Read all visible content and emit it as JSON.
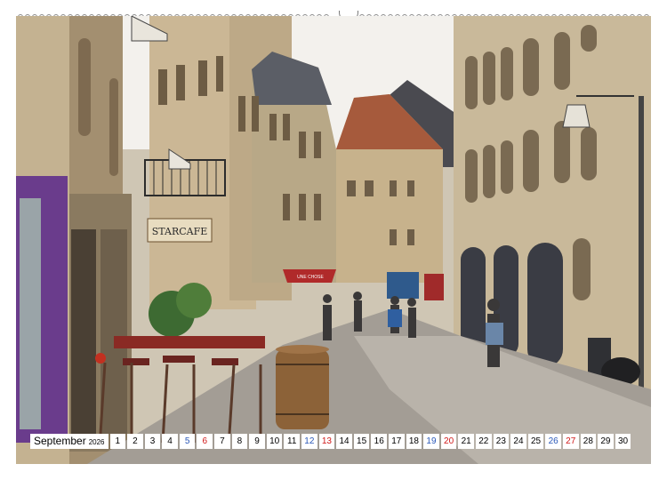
{
  "calendar": {
    "month": "September",
    "year": "2026",
    "days": [
      {
        "n": "1",
        "kind": ""
      },
      {
        "n": "2",
        "kind": ""
      },
      {
        "n": "3",
        "kind": ""
      },
      {
        "n": "4",
        "kind": ""
      },
      {
        "n": "5",
        "kind": "sat"
      },
      {
        "n": "6",
        "kind": "sun"
      },
      {
        "n": "7",
        "kind": ""
      },
      {
        "n": "8",
        "kind": ""
      },
      {
        "n": "9",
        "kind": ""
      },
      {
        "n": "10",
        "kind": ""
      },
      {
        "n": "11",
        "kind": ""
      },
      {
        "n": "12",
        "kind": "sat"
      },
      {
        "n": "13",
        "kind": "sun"
      },
      {
        "n": "14",
        "kind": ""
      },
      {
        "n": "15",
        "kind": ""
      },
      {
        "n": "16",
        "kind": ""
      },
      {
        "n": "17",
        "kind": ""
      },
      {
        "n": "18",
        "kind": ""
      },
      {
        "n": "19",
        "kind": "sat"
      },
      {
        "n": "20",
        "kind": "sun"
      },
      {
        "n": "21",
        "kind": ""
      },
      {
        "n": "22",
        "kind": ""
      },
      {
        "n": "23",
        "kind": ""
      },
      {
        "n": "24",
        "kind": ""
      },
      {
        "n": "25",
        "kind": ""
      },
      {
        "n": "26",
        "kind": "sat"
      },
      {
        "n": "27",
        "kind": "sun"
      },
      {
        "n": "28",
        "kind": ""
      },
      {
        "n": "29",
        "kind": ""
      },
      {
        "n": "30",
        "kind": ""
      }
    ]
  },
  "photo": {
    "signs": {
      "cafe": "STARCAFE",
      "shop": "UNE CHOSE"
    }
  },
  "colors": {
    "sunday": "#d01818",
    "saturday": "#2a58b8",
    "facade_purple": "#6a3c8c",
    "stone": "#c9b99a"
  }
}
